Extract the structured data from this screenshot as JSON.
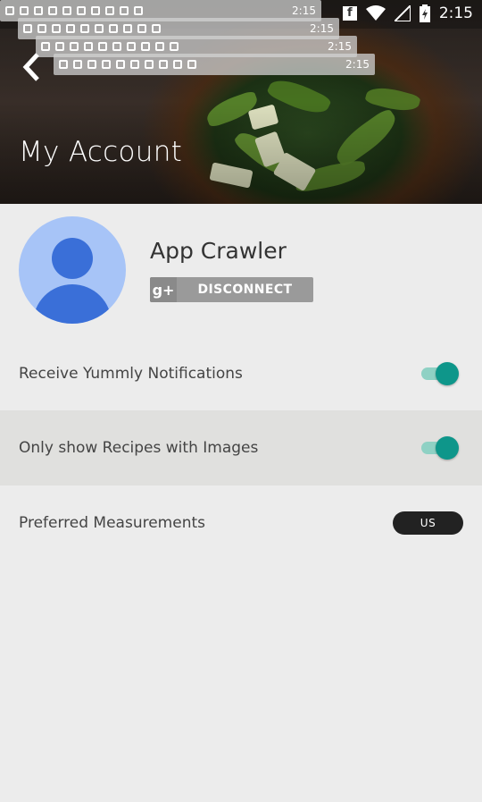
{
  "status_bar": {
    "time": "2:15",
    "ghost_time": "2:15"
  },
  "header": {
    "title": "My Account",
    "back_icon": "chevron-left-icon"
  },
  "profile": {
    "name": "App Crawler",
    "disconnect_label": "DISCONNECT",
    "gplus_label": "g+"
  },
  "settings": [
    {
      "label": "Receive Yummly Notifications",
      "type": "toggle",
      "on": true
    },
    {
      "label": "Only show Recipes with Images",
      "type": "toggle",
      "on": true
    },
    {
      "label": "Preferred Measurements",
      "type": "pill",
      "value": "US"
    }
  ],
  "colors": {
    "accent": "#0e968a",
    "track": "#8fd1c4",
    "avatar_bg": "#a7c4f7",
    "avatar_fg": "#3a6fd8"
  }
}
